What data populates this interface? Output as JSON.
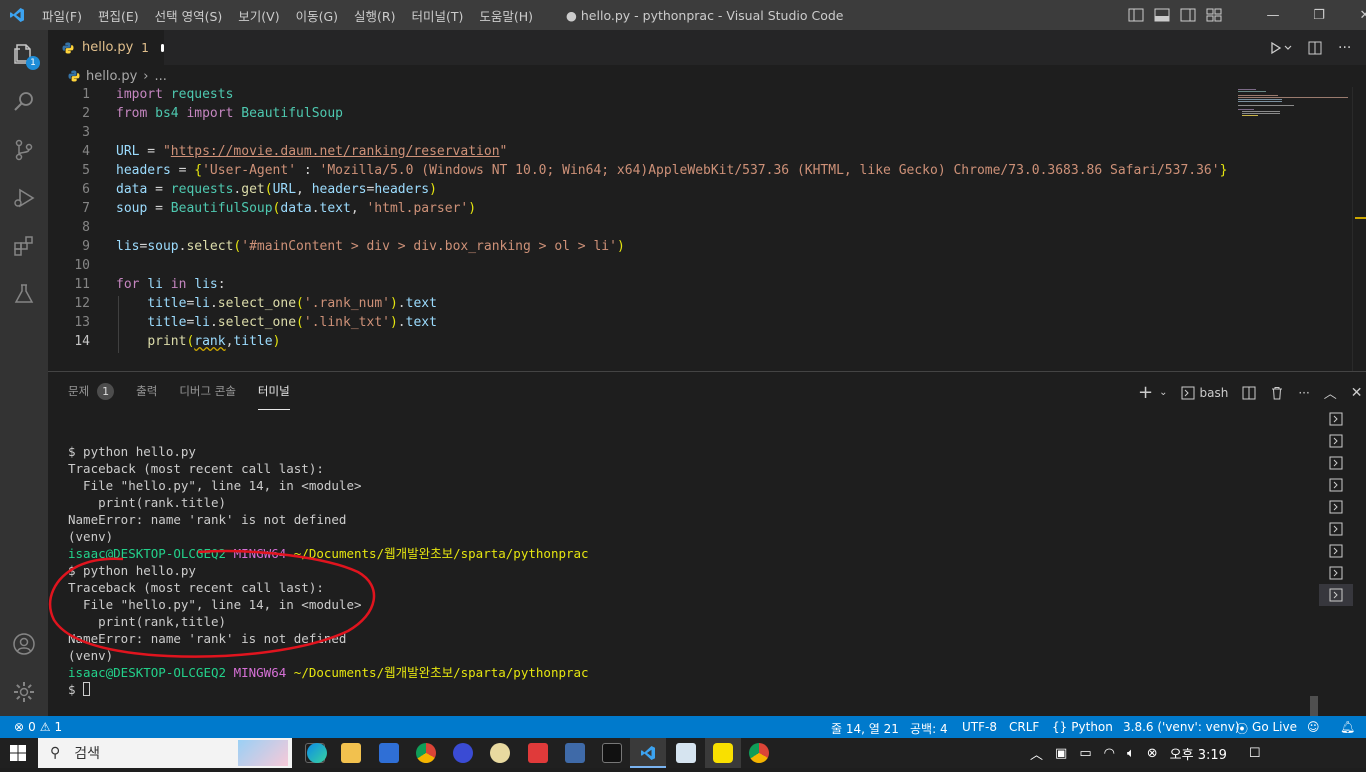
{
  "titlebar": {
    "menu": [
      "파일(F)",
      "편집(E)",
      "선택 영역(S)",
      "보기(V)",
      "이동(G)",
      "실행(R)",
      "터미널(T)",
      "도움말(H)"
    ],
    "window_title": "● hello.py - pythonprac - Visual Studio Code"
  },
  "activity_bar": {
    "explorer_badge": "1"
  },
  "tab": {
    "filename": "hello.py",
    "problems": "1"
  },
  "breadcrumb": {
    "file": "hello.py",
    "more": "..."
  },
  "editor": {
    "line_numbers": [
      "1",
      "2",
      "3",
      "4",
      "5",
      "6",
      "7",
      "8",
      "9",
      "10",
      "11",
      "12",
      "13",
      "14"
    ],
    "current_line": "14"
  },
  "panel": {
    "tabs": {
      "problems": "문제",
      "problems_count": "1",
      "output": "출력",
      "debug_console": "디버그 콘솔",
      "terminal": "터미널"
    },
    "shell": "bash",
    "terminal_lines": {
      "l1": "$ python hello.py",
      "l2": "Traceback (most recent call last):",
      "l3": "  File \"hello.py\", line 14, in <module>",
      "l4": "    print(rank.title)",
      "l5": "NameError: name 'rank' is not defined",
      "l6": "(venv)",
      "prompt_user": "isaac@DESKTOP-OLCGEQ2",
      "prompt_env": "MINGW64",
      "prompt_path": "~/Documents/웹개발완초보/sparta/pythonprac",
      "l8": "$ python hello.py",
      "l9": "Traceback (most recent call last):",
      "l10": "  File \"hello.py\", line 14, in <module>",
      "l11": "    print(rank,title)",
      "l12": "NameError: name 'rank' is not defined",
      "l13": "(venv)",
      "l15": "$ "
    }
  },
  "statusbar": {
    "errors": "0",
    "warnings": "1",
    "position": "줄 14, 열 21",
    "spaces": "공백: 4",
    "encoding": "UTF-8",
    "eol": "CRLF",
    "language": "Python",
    "interpreter": "3.8.6 ('venv': venv)",
    "golive": "Go Live"
  },
  "taskbar": {
    "search_placeholder": "검색",
    "time": "오후 3:19"
  },
  "colors": {
    "accent": "#007acc",
    "titlebar": "#3c3c3c",
    "editor_bg": "#1e1e1e",
    "annotation": "#e0141e"
  }
}
